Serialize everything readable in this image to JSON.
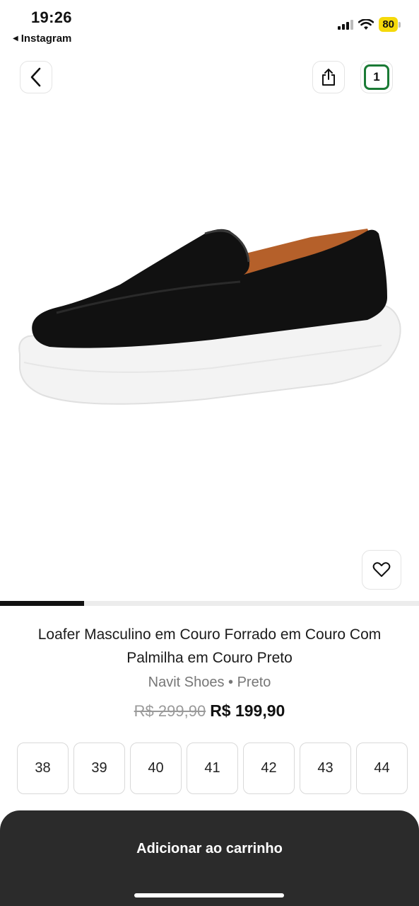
{
  "status_bar": {
    "time": "19:26",
    "back_app": "Instagram",
    "battery": "80",
    "battery_color": "#f5d90a",
    "icons": [
      "signal-icon",
      "wifi-icon",
      "battery-icon"
    ]
  },
  "nav": {
    "back_icon": "chevron-left-icon",
    "share_icon": "share-icon",
    "cart_count": "1",
    "cart_color": "#1a7a35"
  },
  "carousel": {
    "progress": 0.2
  },
  "product": {
    "title": "Loafer Masculino em Couro Forrado em Couro Com Palmilha em Couro Preto",
    "meta": "Navit Shoes • Preto",
    "old_price": "R$ 299,90",
    "new_price": "R$ 199,90",
    "image": "black-suede-loafer-white-sole"
  },
  "sizes": [
    "38",
    "39",
    "40",
    "41",
    "42",
    "43",
    "44"
  ],
  "cta": {
    "label": "Adicionar ao carrinho",
    "background": "#2b2b2b"
  }
}
